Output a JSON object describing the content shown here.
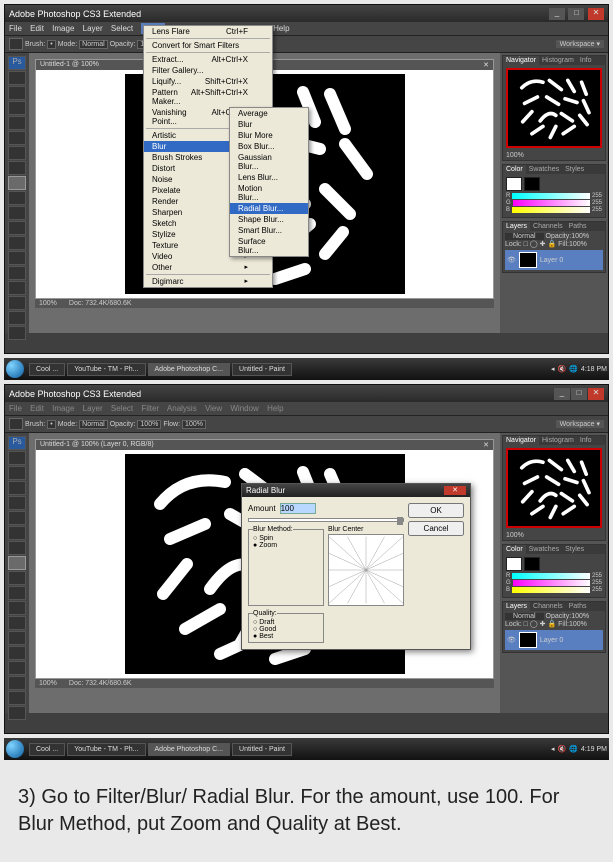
{
  "app_title": "Adobe Photoshop CS3 Extended",
  "menubar": {
    "items": [
      "File",
      "Edit",
      "Image",
      "Layer",
      "Select",
      "Filter",
      "Analysis",
      "View",
      "Window",
      "Help"
    ],
    "active": "Filter"
  },
  "optionsbar": {
    "brush_lbl": "Brush:",
    "mode_lbl": "Mode:",
    "mode_val": "Normal",
    "opacity_lbl": "Opacity:",
    "opacity_val": "100%",
    "flow_lbl": "Flow:",
    "flow_val": "100%",
    "workspace": "Workspace ▾"
  },
  "doc": {
    "title_top": "Untitled-1 @ 100%",
    "title_full": "Untitled-1 @ 100% (Layer 0, RGB/8)",
    "zoom": "100%",
    "docsize": "Doc: 732.4K/680.6K"
  },
  "filter_menu": {
    "items": [
      {
        "label": "Lens Flare",
        "shortcut": "Ctrl+F"
      },
      {
        "sep": true
      },
      {
        "label": "Convert for Smart Filters"
      },
      {
        "sep": true
      },
      {
        "label": "Extract...",
        "shortcut": "Alt+Ctrl+X"
      },
      {
        "label": "Filter Gallery..."
      },
      {
        "label": "Liquify...",
        "shortcut": "Shift+Ctrl+X"
      },
      {
        "label": "Pattern Maker...",
        "shortcut": "Alt+Shift+Ctrl+X"
      },
      {
        "label": "Vanishing Point...",
        "shortcut": "Alt+Ctrl+V"
      },
      {
        "sep": true
      },
      {
        "label": "Artistic",
        "arrow": true
      },
      {
        "label": "Blur",
        "arrow": true,
        "hl": true
      },
      {
        "label": "Brush Strokes",
        "arrow": true
      },
      {
        "label": "Distort",
        "arrow": true
      },
      {
        "label": "Noise",
        "arrow": true
      },
      {
        "label": "Pixelate",
        "arrow": true
      },
      {
        "label": "Render",
        "arrow": true
      },
      {
        "label": "Sharpen",
        "arrow": true
      },
      {
        "label": "Sketch",
        "arrow": true
      },
      {
        "label": "Stylize",
        "arrow": true
      },
      {
        "label": "Texture",
        "arrow": true
      },
      {
        "label": "Video",
        "arrow": true
      },
      {
        "label": "Other",
        "arrow": true
      },
      {
        "sep": true
      },
      {
        "label": "Digimarc",
        "arrow": true
      }
    ]
  },
  "blur_submenu": {
    "items": [
      "Average",
      "Blur",
      "Blur More",
      "Box Blur...",
      "Gaussian Blur...",
      "Lens Blur...",
      "Motion Blur...",
      "Radial Blur...",
      "Shape Blur...",
      "Smart Blur...",
      "Surface Blur..."
    ],
    "hl": "Radial Blur..."
  },
  "panels": {
    "nav_tabs": [
      "Navigator",
      "Histogram",
      "Info"
    ],
    "nav_zoom": "100%",
    "color_tabs": [
      "Color",
      "Swatches",
      "Styles"
    ],
    "rgb": [
      {
        "ch": "R",
        "val": "255"
      },
      {
        "ch": "G",
        "val": "255"
      },
      {
        "ch": "B",
        "val": "255"
      }
    ],
    "layer_tabs": [
      "Layers",
      "Channels",
      "Paths"
    ],
    "blend": "Normal",
    "opacity": "Opacity:",
    "opacity_v": "100%",
    "lock": "Lock:",
    "fill": "Fill:",
    "fill_v": "100%",
    "layer_name": "Layer 0"
  },
  "dialog": {
    "title": "Radial Blur",
    "amount_lbl": "Amount",
    "amount_val": "100",
    "ok": "OK",
    "cancel": "Cancel",
    "method_legend": "Blur Method:",
    "spin": "Spin",
    "zoom": "Zoom",
    "quality_legend": "Quality:",
    "draft": "Draft",
    "good": "Good",
    "best": "Best",
    "center_lbl": "Blur Center"
  },
  "taskbar": {
    "items": [
      "Cool ...",
      "YouTube - TM - Ph...",
      "Adobe Photoshop C...",
      "Untitled - Paint"
    ],
    "time1": "4:18 PM",
    "time2": "4:19 PM"
  },
  "caption": "3) Go to Filter/Blur/ Radial Blur. For the amount, use 100. For Blur Method, put Zoom and Quality at Best."
}
